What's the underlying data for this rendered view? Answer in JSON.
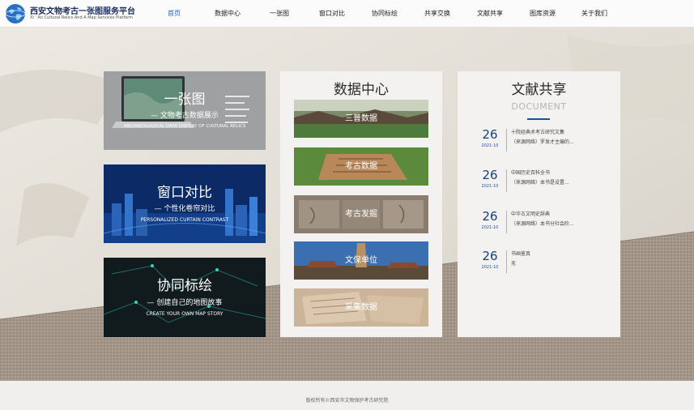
{
  "brand": {
    "title": "西安文物考古一张图服务平台",
    "subtitle": "Xi ' An Cultural Relics And A Map  Services Platform"
  },
  "nav": [
    {
      "label": "首页",
      "active": true
    },
    {
      "label": "数据中心"
    },
    {
      "label": "一张图"
    },
    {
      "label": "窗口对比"
    },
    {
      "label": "协同标绘"
    },
    {
      "label": "共享交换"
    },
    {
      "label": "文献共享"
    },
    {
      "label": "图库资源"
    },
    {
      "label": "关于我们"
    }
  ],
  "cards": {
    "map": {
      "title": "一张图",
      "subtitle": "文物考古数据展示",
      "english": "ARCHAEOLOGICAL DATA DISPLAY OF CULTURAL RELICS"
    },
    "compare": {
      "title": "窗口对比",
      "subtitle": "个性化卷帘对比",
      "english": "PERSONALIZED CURTAIN CONTRAST"
    },
    "plot": {
      "title": "协同标绘",
      "subtitle": "创建自己的地图故事",
      "english": "CREATE YOUR OWN MAP STORY"
    }
  },
  "data_center": {
    "title": "数据中心",
    "items": [
      "三普数据",
      "考古数据",
      "考古发掘",
      "文保单位",
      "采集数据"
    ]
  },
  "documents": {
    "title": "文献共享",
    "subtitle": "DOCUMENT",
    "items": [
      {
        "day": "26",
        "date": "2021-10",
        "line1": "十院经典术考古研究文集",
        "line2": "（来源网络）罗发才主编的..."
      },
      {
        "day": "26",
        "date": "2021-10",
        "line1": "中国历史百科全书",
        "line2": "（来源网络）本书是设置..."
      },
      {
        "day": "26",
        "date": "2021-10",
        "line1": "中华古文明史辞典",
        "line2": "（来源网络）本书分社会阶..."
      },
      {
        "day": "26",
        "date": "2021-10",
        "line1": "书画鉴真",
        "line2": "无"
      }
    ]
  },
  "footer": {
    "copyright": "版权所有©西安市文物保护考古研究院"
  },
  "colors": {
    "accent": "#1d62c4",
    "brand": "#1b2f5e",
    "date": "#173f7a"
  }
}
